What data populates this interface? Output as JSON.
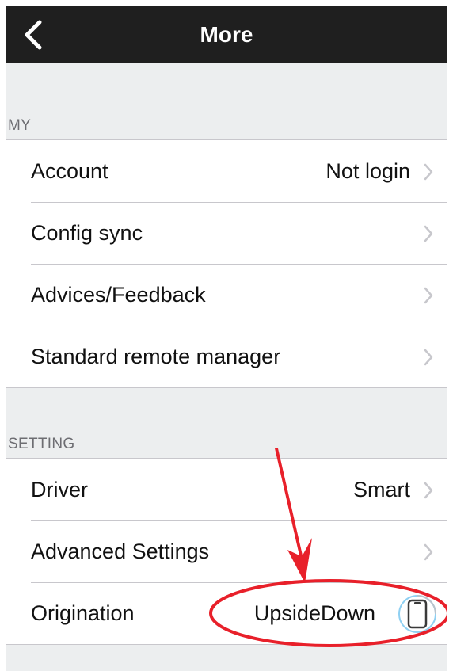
{
  "nav": {
    "title": "More",
    "back_icon": "chevron-left-icon"
  },
  "sections": {
    "my": {
      "header": "MY",
      "items": {
        "account": {
          "label": "Account",
          "value": "Not login"
        },
        "config_sync": {
          "label": "Config sync"
        },
        "advices_feedback": {
          "label": "Advices/Feedback"
        },
        "standard_remote_manager": {
          "label": "Standard remote manager"
        }
      }
    },
    "setting": {
      "header": "SETTING",
      "items": {
        "driver": {
          "label": "Driver",
          "value": "Smart"
        },
        "advanced_settings": {
          "label": "Advanced Settings"
        },
        "origination": {
          "label": "Origination",
          "value": "UpsideDown",
          "icon": "phone-orientation-icon"
        }
      }
    }
  },
  "colors": {
    "navbar_bg": "#1f1f1f",
    "page_bg": "#eceeef",
    "chevron": "#c7c7cc",
    "annotation": "#e8202a",
    "icon_ring": "#8fd0f2"
  }
}
